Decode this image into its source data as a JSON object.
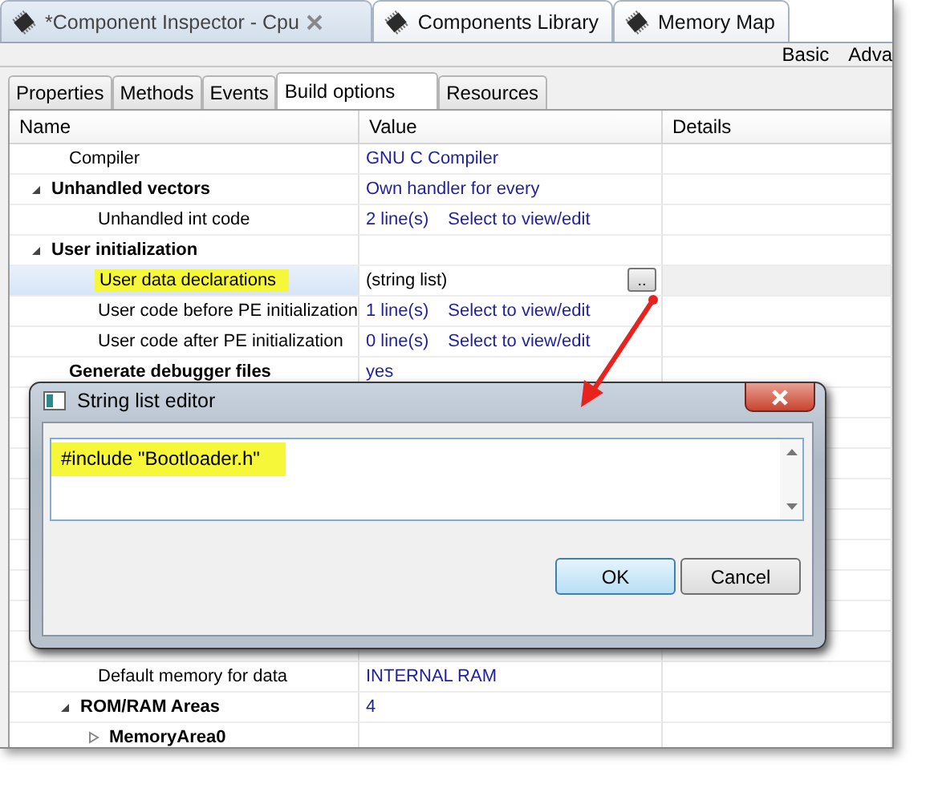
{
  "editor_tabs": [
    {
      "label": "*Component Inspector - Cpu",
      "selected": true,
      "closable": true
    },
    {
      "label": "Components Library",
      "selected": false,
      "closable": false
    },
    {
      "label": "Memory Map",
      "selected": false,
      "closable": false
    }
  ],
  "view_modes": [
    "Basic",
    "Adva"
  ],
  "tabs": [
    {
      "label": "Properties",
      "selected": false
    },
    {
      "label": "Methods",
      "selected": false
    },
    {
      "label": "Events",
      "selected": false
    },
    {
      "label": "Build options",
      "selected": true
    },
    {
      "label": "Resources",
      "selected": false
    }
  ],
  "table": {
    "columns": [
      "Name",
      "Value",
      "Details"
    ],
    "rows": [
      {
        "kind": "property",
        "name": "Compiler",
        "value": "GNU C Compiler",
        "selected": false,
        "highlighted": false
      },
      {
        "kind": "group",
        "name": "Unhandled vectors",
        "value": "Own handler for every",
        "expanded": true,
        "selected": false,
        "highlighted": false,
        "children": [
          {
            "kind": "property",
            "name": "Unhandled int code",
            "value": "2 line(s)",
            "action": "Select to view/edit",
            "selected": false,
            "highlighted": false
          }
        ]
      },
      {
        "kind": "group",
        "name": "User initialization",
        "expanded": true,
        "selected": false,
        "highlighted": false,
        "children": [
          {
            "kind": "property",
            "name": "User data declarations",
            "value": "(string list)",
            "edit_button": "..",
            "selected": true,
            "highlighted": true
          },
          {
            "kind": "property",
            "name": "User code before PE initialization",
            "value": "1 line(s)",
            "action": "Select to view/edit",
            "selected": false,
            "highlighted": false
          },
          {
            "kind": "property",
            "name": "User code after PE initialization",
            "value": "0 line(s)",
            "action": "Select to view/edit",
            "selected": false,
            "highlighted": false
          }
        ]
      },
      {
        "kind": "group",
        "name": "Generate debugger files",
        "value": "yes",
        "selected": false,
        "highlighted": false
      }
    ],
    "lower_rows": [
      {
        "kind": "property",
        "name": "Default memory for data",
        "value": "INTERNAL RAM",
        "selected": false,
        "highlighted": false
      },
      {
        "kind": "group",
        "name": "ROM/RAM Areas",
        "value": "4",
        "expanded": true,
        "selected": false,
        "highlighted": false,
        "children": [
          {
            "kind": "group",
            "name": "MemoryArea0",
            "expanded": false,
            "selected": false,
            "highlighted": false
          }
        ]
      }
    ]
  },
  "dialog": {
    "title": "String list editor",
    "lines": [
      {
        "text": "#include \"Bootloader.h\"",
        "highlighted": true
      }
    ],
    "buttons": [
      {
        "label": "OK",
        "default": true
      },
      {
        "label": "Cancel",
        "default": false
      }
    ]
  }
}
